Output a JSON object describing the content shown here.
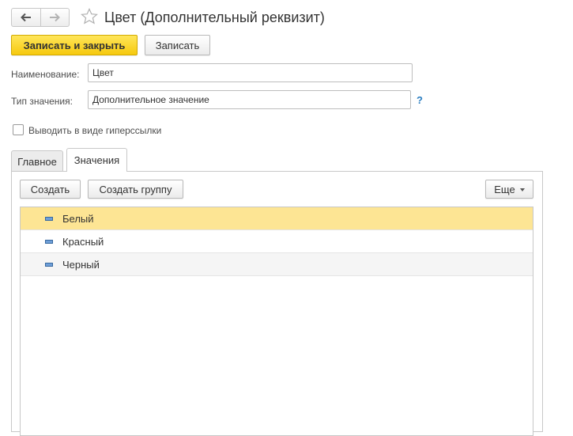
{
  "window": {
    "title": "Цвет (Дополнительный реквизит)"
  },
  "toolbar": {
    "save_close_label": "Записать и закрыть",
    "save_label": "Записать"
  },
  "form": {
    "name_label": "Наименование:",
    "name_value": "Цвет",
    "type_label": "Тип значения:",
    "type_value": "Дополнительное значение",
    "help_symbol": "?",
    "hyperlink_label": "Выводить в виде гиперссылки",
    "hyperlink_checked": false
  },
  "tabs": [
    {
      "label": "Главное",
      "active": false
    },
    {
      "label": "Значения",
      "active": true
    }
  ],
  "values_toolbar": {
    "create_label": "Создать",
    "create_group_label": "Создать группу",
    "more_label": "Еще"
  },
  "values_list": [
    {
      "label": "Белый",
      "selected": true
    },
    {
      "label": "Красный",
      "selected": false
    },
    {
      "label": "Черный",
      "selected": false
    }
  ],
  "icons": [
    "back-arrow-icon",
    "forward-arrow-icon",
    "favorite-star-icon",
    "help-icon",
    "dropdown-caret-icon",
    "list-item-icon"
  ],
  "colors": {
    "primary_button": "#f6c90e",
    "selected_row": "#fde594",
    "help": "#2b7ec1"
  }
}
